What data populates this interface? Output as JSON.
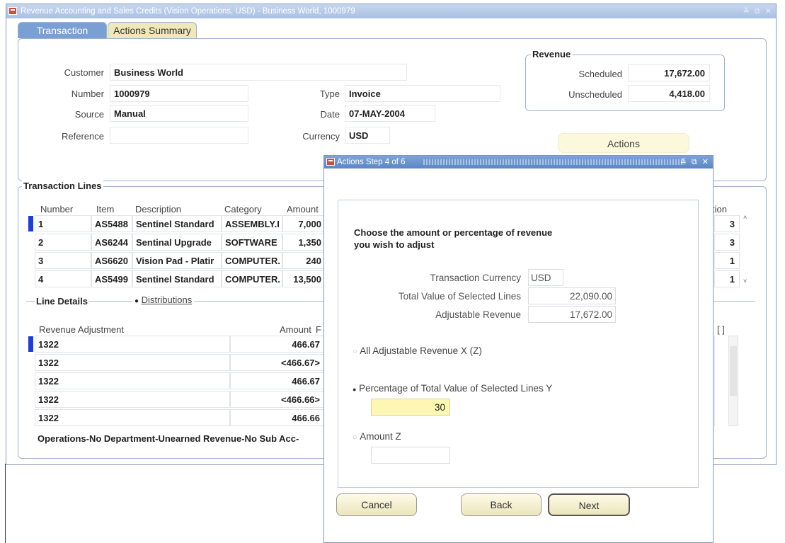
{
  "window": {
    "title": "Revenue Accounting and Sales Credits (Vision Operations, USD) - Business World, 1000979",
    "controls": "≚ ⧉ ✕"
  },
  "tabs": {
    "transaction": "Transaction",
    "actions_summary": "Actions Summary"
  },
  "header": {
    "customer_label": "Customer",
    "customer_value": "Business World",
    "number_label": "Number",
    "number_value": "1000979",
    "source_label": "Source",
    "source_value": "Manual",
    "reference_label": "Reference",
    "reference_value": "",
    "type_label": "Type",
    "type_value": "Invoice",
    "date_label": "Date",
    "date_value": "07-MAY-2004",
    "currency_label": "Currency",
    "currency_value": "USD"
  },
  "revenue": {
    "title": "Revenue",
    "scheduled_label": "Scheduled",
    "scheduled_value": "17,672.00",
    "unscheduled_label": "Unscheduled",
    "unscheduled_value": "4,418.00"
  },
  "actions_button": "Actions",
  "transaction_lines": {
    "title": "Transaction Lines",
    "columns": {
      "number": "Number",
      "item": "Item",
      "description": "Description",
      "category": "Category",
      "amount": "Amount",
      "action": "tion"
    },
    "rows": [
      {
        "number": "1",
        "item": "AS5488",
        "description": "Sentinel Standard",
        "category": "ASSEMBLY.I",
        "amount": "7,000",
        "action": "3"
      },
      {
        "number": "2",
        "item": "AS6244",
        "description": "Sentinal Upgrade",
        "category": "SOFTWARE",
        "amount": "1,350",
        "action": "3"
      },
      {
        "number": "3",
        "item": "AS6620",
        "description": "Vision Pad - Platir",
        "category": "COMPUTER.",
        "amount": "240",
        "action": "1"
      },
      {
        "number": "4",
        "item": "AS5499",
        "description": "Sentinel Standard",
        "category": "COMPUTER.",
        "amount": "13,500",
        "action": "1"
      }
    ]
  },
  "line_details": {
    "title": "Line Details",
    "distributions_label": "Distributions",
    "columns": {
      "revenue_adjustment": "Revenue Adjustment",
      "amount": "Amount",
      "extra": "F",
      "flag": "[ ]"
    },
    "rows": [
      {
        "adjustment": "1322",
        "amount": "466.67"
      },
      {
        "adjustment": "1322",
        "amount": "<466.67>"
      },
      {
        "adjustment": "1322",
        "amount": "466.67"
      },
      {
        "adjustment": "1322",
        "amount": "<466.66>"
      },
      {
        "adjustment": "1322",
        "amount": "466.66"
      }
    ],
    "account_description": "Operations-No Department-Unearned Revenue-No Sub Acc-"
  },
  "dialog": {
    "title": "Actions Step 4 of 6",
    "controls": "≚ ⧉ ✕",
    "instruction_line1": "Choose the amount or percentage of revenue",
    "instruction_line2": "you wish to adjust",
    "currency_label": "Transaction Currency",
    "currency_value": "USD",
    "total_label": "Total Value of Selected Lines",
    "total_value": "22,090.00",
    "adjustable_label": "Adjustable Revenue",
    "adjustable_value": "17,672.00",
    "option_all": "All Adjustable Revenue X (Z)",
    "option_percentage": "Percentage of Total Value of Selected Lines Y",
    "percentage_value": "30",
    "option_amount": "Amount Z",
    "amount_value": "",
    "cancel_button": "Cancel",
    "back_button": "Back",
    "next_button": "Next"
  },
  "colors": {
    "title_bar": "#a9c0e2",
    "active_tab": "#7a9fd4",
    "inactive_tab": "#efe8b8",
    "record_marker": "#1d3fd8",
    "input_highlight": "#fdf7b3"
  }
}
